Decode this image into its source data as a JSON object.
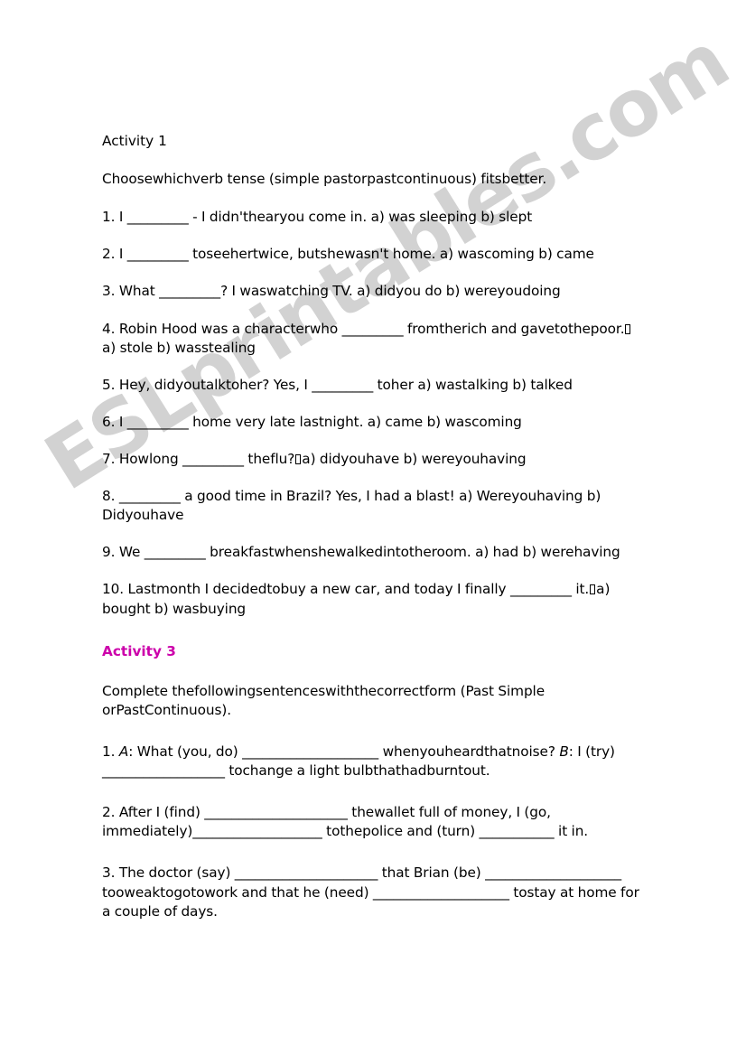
{
  "document": {
    "watermark": "ESLprintables.com",
    "accent_color": "#cc00aa",
    "text_color": "#000000",
    "background_color": "#ffffff"
  },
  "activity1": {
    "heading": "Activity 1",
    "instructions": "Choosewhichverb tense (simple pastorpastcontinuous) fitsbetter.",
    "questions": [
      {
        "number": "1.",
        "pre": "I ",
        "blank": "_________",
        "post": " - I didn'thearyou come in. a) was sleeping b) slept"
      },
      {
        "number": "2.",
        "pre": "I ",
        "blank": "_________",
        "post": " toseehertwice, butshewasn't home. a) wascoming b) came"
      },
      {
        "number": "3.",
        "pre": "What ",
        "blank": "_________",
        "post": "? I waswatching TV. a) didyou do b) wereyoudoing"
      },
      {
        "number": "4.",
        "pre": "Robin Hood was a characterwho ",
        "blank": "_________",
        "post": " fromtherich and gavetothepoor.",
        "tofu_after": true,
        "tail": "a) stole b) wasstealing"
      },
      {
        "number": "5.",
        "pre": "Hey, didyoutalktoher? Yes, I ",
        "blank": "_________",
        "post": " toher a) wastalking b) talked"
      },
      {
        "number": "6.",
        "pre": "I ",
        "blank": "_________",
        "post": " home very late lastnight. a) came b) wascoming"
      },
      {
        "number": "7.",
        "pre": "Howlong ",
        "blank": "_________",
        "post": " theflu?",
        "tofu_after": true,
        "tail": "a) didyouhave b) wereyouhaving"
      },
      {
        "number": "8.",
        "pre": " ",
        "blank": "_________",
        "post": " a good time in Brazil? Yes, I had a blast! a) Wereyouhaving b) Didyouhave"
      },
      {
        "number": "9.",
        "pre": "We ",
        "blank": "_________",
        "post": " breakfastwhenshewalkedintotheroom. a) had b) werehaving"
      },
      {
        "number": "10.",
        "pre": "Lastmonth I decidedtobuy a new car, and today I finally ",
        "blank": "_________",
        "post": " it.",
        "tofu_after": true,
        "tail": "a) bought b) wasbuying"
      }
    ]
  },
  "activity3": {
    "heading": "Activity 3",
    "instructions": "Complete thefollowingsentenceswiththecorrectform (Past Simple orPastContinuous).",
    "q1": {
      "number": "1.",
      "speaker_a": "A",
      "seg1": ": What (you, do) ",
      "blank1": "____________________",
      "seg2": " whenyouheardthatnoise? ",
      "speaker_b": "B",
      "seg3": ": I (try) ",
      "blank2": "__________________",
      "seg4": " tochange a light bulbthathadburntout."
    },
    "q2": {
      "number": "2.",
      "seg1": "After I (find) ",
      "blank1": "_____________________",
      "seg2": " thewallet full of money, I (go, immediately)",
      "blank2": "___________________",
      "seg3": " tothepolice and (turn) ",
      "blank3": "___________",
      "seg4": " it in."
    },
    "q3": {
      "number": "3.",
      "seg1": "The doctor (say) ",
      "blank1": "_____________________",
      "seg2": " that Brian (be) ",
      "blank2": "____________________",
      "seg3": " tooweaktogotowork and that he (need) ",
      "blank3": "____________________",
      "seg4": " tostay at home for a couple of days."
    }
  }
}
